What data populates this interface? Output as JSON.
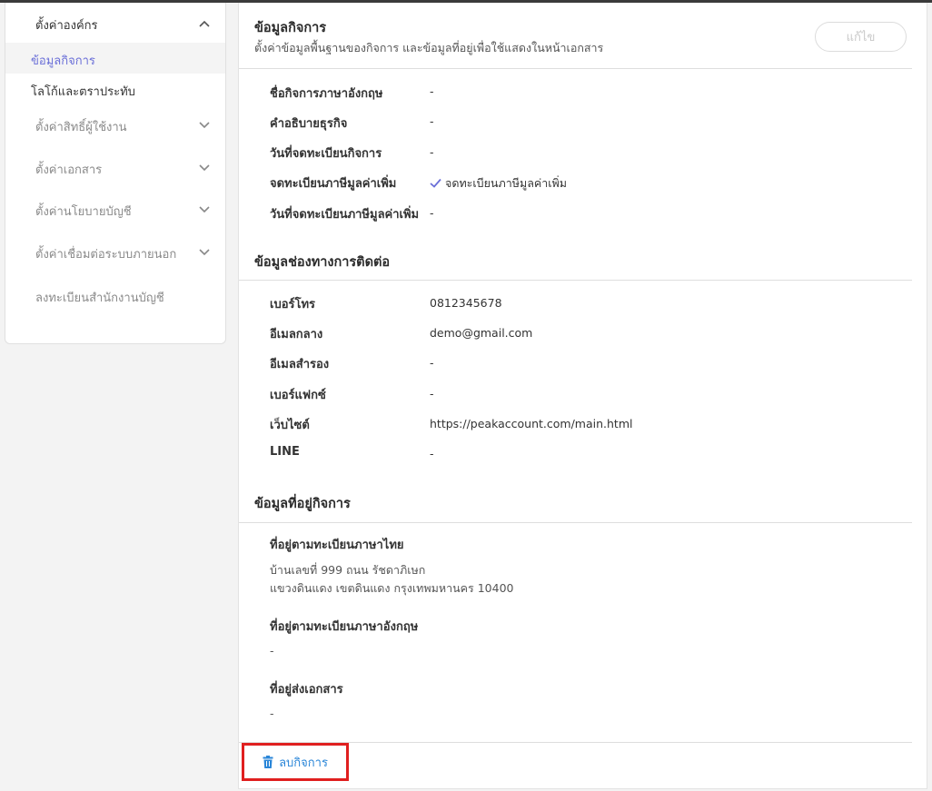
{
  "sidebar": {
    "group_title": "ตั้งค่าองค์กร",
    "sub_items": [
      {
        "label": "ข้อมูลกิจการ",
        "active": true
      },
      {
        "label": "โลโก้และตราประทับ",
        "active": false
      }
    ],
    "groups": [
      {
        "label": "ตั้งค่าสิทธิ์ผู้ใช้งาน"
      },
      {
        "label": "ตั้งค่าเอกสาร"
      },
      {
        "label": "ตั้งค่านโยบายบัญชี"
      },
      {
        "label": "ตั้งค่าเชื่อมต่อระบบภายนอก"
      }
    ],
    "register_label": "ลงทะเบียนสำนักงานบัญชี"
  },
  "business": {
    "title": "ข้อมูลกิจการ",
    "subtitle": "ตั้งค่าข้อมูลพื้นฐานของกิจการ และข้อมูลที่อยู่เพื่อใช้แสดงในหน้าเอกสาร",
    "edit_label": "แก้ไข",
    "rows": [
      {
        "label": "ชื่อกิจการภาษาอังกฤษ",
        "value": "-"
      },
      {
        "label": "คำอธิบายธุรกิจ",
        "value": "-"
      },
      {
        "label": "วันที่จดทะเบียนกิจการ",
        "value": "-"
      },
      {
        "label": "จดทะเบียนภาษีมูลค่าเพิ่ม",
        "value": "จดทะเบียนภาษีมูลค่าเพิ่ม"
      },
      {
        "label": "วันที่จดทะเบียนภาษีมูลค่าเพิ่ม",
        "value": "-"
      }
    ]
  },
  "contact": {
    "title": "ข้อมูลช่องทางการติดต่อ",
    "rows": [
      {
        "label": "เบอร์โทร",
        "value": "0812345678"
      },
      {
        "label": "อีเมลกลาง",
        "value": "demo@gmail.com"
      },
      {
        "label": "อีเมลสำรอง",
        "value": "-"
      },
      {
        "label": "เบอร์แฟกซ์",
        "value": "-"
      },
      {
        "label": "เว็บไซต์",
        "value": "https://peakaccount.com/main.html"
      },
      {
        "label": "LINE",
        "value": "-"
      }
    ]
  },
  "address": {
    "title": "ข้อมูลที่อยู่กิจการ",
    "thai_label": "ที่อยู่ตามทะเบียนภาษาไทย",
    "thai_line1": "บ้านเลขที่ 999 ถนน รัชดาภิเษก",
    "thai_line2": "แขวงดินแดง เขตดินแดง กรุงเทพมหานคร 10400",
    "eng_label": "ที่อยู่ตามทะเบียนภาษาอังกฤษ",
    "eng_value": "-",
    "mail_label": "ที่อยู่ส่งเอกสาร",
    "mail_value": "-"
  },
  "actions": {
    "delete_label": "ลบกิจการ"
  },
  "colors": {
    "accent": "#6a6fd8",
    "link": "#2a86d8",
    "highlight_border": "#e01f1f"
  }
}
